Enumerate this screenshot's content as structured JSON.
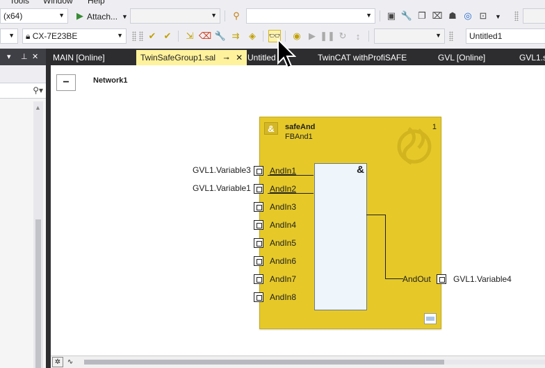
{
  "menu": {
    "items": [
      "Tools",
      "Window",
      "Help"
    ]
  },
  "toolbar1": {
    "platform": "(x64)",
    "attach_label": "Attach...",
    "config_combo": "",
    "search_combo": ""
  },
  "toolbar2": {
    "target_system": "CX-7E23BE",
    "project_combo": "",
    "doc_combo": "Untitled1"
  },
  "tabs": [
    {
      "label": "MAIN [Online]"
    },
    {
      "label": "TwinSafeGroup1.sal",
      "active": true
    },
    {
      "label": "Untitled"
    },
    {
      "label": "TwinCAT withProfiSAFE"
    },
    {
      "label": "GVL [Online]"
    },
    {
      "label": "GVL1.s"
    }
  ],
  "editor": {
    "network_title": "Network1",
    "collapse_symbol": "−",
    "block": {
      "type": "safeAnd",
      "instance": "FBAnd1",
      "number": "1",
      "operator": "&",
      "inputs": [
        "AndIn1",
        "AndIn2",
        "AndIn3",
        "AndIn4",
        "AndIn5",
        "AndIn6",
        "AndIn7",
        "AndIn8"
      ],
      "connected_inputs": [
        {
          "pin": "AndIn1",
          "variable": "GVL1.Variable3"
        },
        {
          "pin": "AndIn2",
          "variable": "GVL1.Variable1"
        }
      ],
      "output": "AndOut",
      "output_variable": "GVL1.Variable4"
    }
  },
  "colors": {
    "block_fill": "#e6c929",
    "active_tab": "#fff29d",
    "tabstrip": "#2d2d30"
  }
}
